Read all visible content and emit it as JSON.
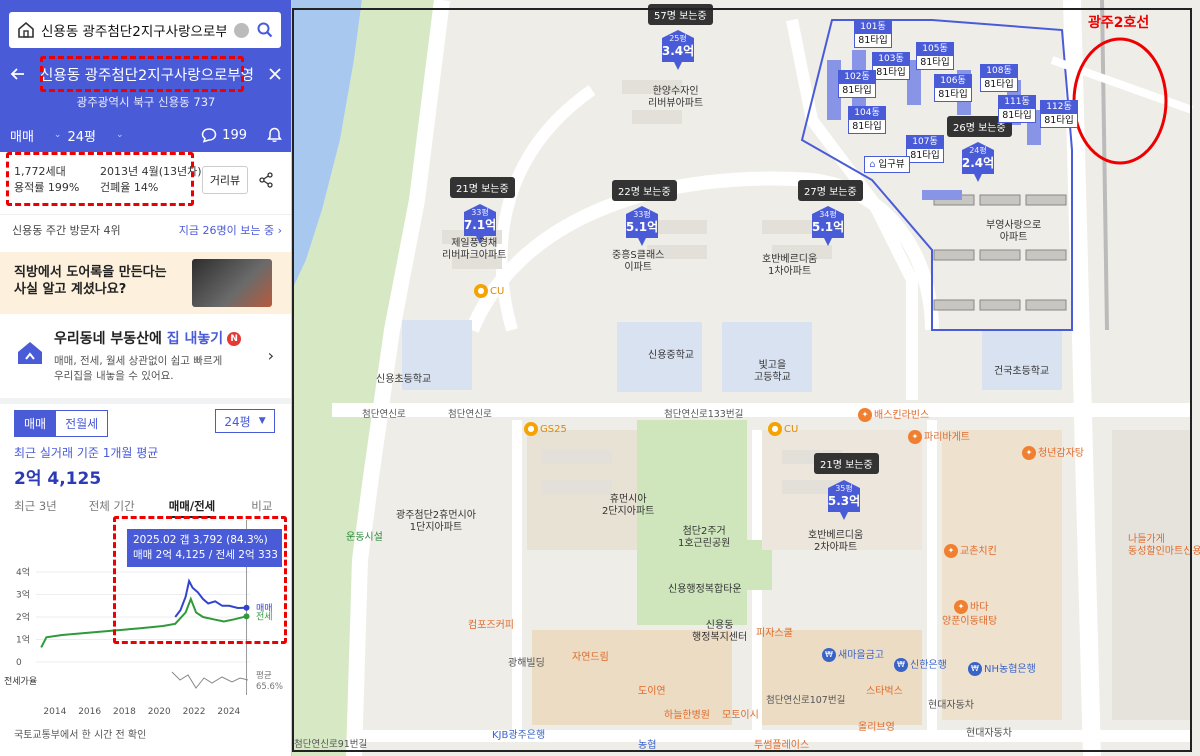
{
  "search": {
    "query": "신용동 광주첨단2지구사랑으로부영"
  },
  "header": {
    "title": "신용동 광주첨단2지구사랑으로부영",
    "address": "광주광역시 북구 신용동 737"
  },
  "tabs": {
    "deal": "매매",
    "size": "24평",
    "comments": "199"
  },
  "info": {
    "households": "1,772세대",
    "built": "2013년 4월(13년차)",
    "far": "용적률 199%",
    "bcr": "건폐율 14%",
    "street_view": "거리뷰"
  },
  "visitors": {
    "left": "신용동 주간 방문자 4위",
    "right": "지금 26명이 보는 중 ›"
  },
  "banner": {
    "line1": "직방에서 도어록을 만든다는",
    "line2": "사실 알고 계셨나요?"
  },
  "promo": {
    "title_a": "우리동네 부동산에 ",
    "title_b": "집 내놓기",
    "badge": "N",
    "desc1": "매매, 전세, 월세 상관없이 쉽고 빠르게",
    "desc2": "우리집을 내놓을 수 있어요."
  },
  "deal_tabs": {
    "sale": "매매",
    "rent": "전월세",
    "size": "24평"
  },
  "avg": {
    "label": "최근 실거래 기준 1개월 평균",
    "value": "2억 4,125"
  },
  "range_tabs": [
    "최근 3년",
    "전체 기간",
    "매매/전세",
    "비교"
  ],
  "tooltip": {
    "line1": "2025.02  갭 3,792 (84.3%)",
    "line2": "매매 2억 4,125 / 전세 2억 333"
  },
  "source": "국토교통부에서 한 시간 전 확인",
  "chart_data": {
    "type": "line",
    "x_ticks": [
      "2014",
      "2016",
      "2018",
      "2020",
      "2022",
      "2024"
    ],
    "y_ticks": [
      "4억",
      "3억",
      "2억",
      "1억",
      "0"
    ],
    "ylim": [
      0,
      4
    ],
    "series": [
      {
        "name": "매매",
        "color": "#3344cc",
        "points": [
          [
            2021.0,
            2.0
          ],
          [
            2021.3,
            2.3
          ],
          [
            2021.6,
            2.9
          ],
          [
            2021.8,
            3.6
          ],
          [
            2022.0,
            3.3
          ],
          [
            2022.3,
            3.1
          ],
          [
            2022.6,
            2.8
          ],
          [
            2022.9,
            2.6
          ],
          [
            2023.3,
            2.7
          ],
          [
            2023.7,
            2.5
          ],
          [
            2024.1,
            2.5
          ],
          [
            2024.6,
            2.4
          ],
          [
            2025.1,
            2.41
          ]
        ]
      },
      {
        "name": "전세",
        "color": "#2e9a3a",
        "points": [
          [
            2013.3,
            0.65
          ],
          [
            2013.6,
            1.1
          ],
          [
            2014.5,
            1.2
          ],
          [
            2016.0,
            1.3
          ],
          [
            2017.5,
            1.4
          ],
          [
            2019.0,
            1.5
          ],
          [
            2020.3,
            1.6
          ],
          [
            2021.0,
            1.7
          ],
          [
            2021.6,
            2.2
          ],
          [
            2021.9,
            2.8
          ],
          [
            2022.2,
            2.2
          ],
          [
            2022.6,
            2.0
          ],
          [
            2023.2,
            1.9
          ],
          [
            2023.8,
            1.8
          ],
          [
            2024.4,
            1.9
          ],
          [
            2025.1,
            2.03
          ]
        ]
      }
    ],
    "ratio_label": "전세가율",
    "ratio_value": "평균\n65.6%"
  },
  "map": {
    "line_label": "광주2호선",
    "markers": [
      {
        "viewers": "57명 보는중",
        "size": "25평",
        "price": "3.4억"
      },
      {
        "viewers": "21명 보는중",
        "size": "33평",
        "price": "7.1억"
      },
      {
        "viewers": "22명 보는중",
        "size": "33평",
        "price": "5.1억"
      },
      {
        "viewers": "27명 보는중",
        "size": "34평",
        "price": "5.1억"
      },
      {
        "viewers": "26명 보는중",
        "size": "24평",
        "price": "2.4억"
      },
      {
        "viewers": "21명 보는중",
        "size": "35평",
        "price": "5.3억"
      }
    ],
    "units": [
      "101동",
      "103동",
      "102동",
      "104동",
      "105동",
      "106동",
      "108동",
      "111동",
      "112동",
      "107동"
    ],
    "unit_type": "81타입",
    "entrance": "입구뷰",
    "labels": {
      "hanyang": "한양수자인\n리버뷰아파트",
      "jeil": "제일풍경채\n리버파크아파트",
      "jungheung": "중흥S클래스\n이파트",
      "hoban1": "호반베르디움\n1차아파트",
      "buyoung": "부영사랑으로\n아파트",
      "sinyong_elem": "신용초등학교",
      "sinyong_mid": "신용중학교",
      "bitgoeul": "빛고을\n고등학교",
      "geonguk": "건국초등학교",
      "humansia": "광주첨단2휴먼시아\n1단지아파트",
      "humansia2": "휴먼시아\n2단지아파트",
      "park": "첨단2주거\n1호근린공원",
      "hoban2": "호반베르디움\n2차아파트",
      "welfare": "신용동\n행정복지센터",
      "tower": "신용행정복합타운",
      "gs25": "GS25",
      "cu1": "CU",
      "cu2": "CU",
      "baskin": "배스킨라빈스",
      "paris": "파리바게트",
      "cheongnyeon": "청년감자탕",
      "kyochon": "교촌치킨",
      "bada": "바다",
      "yangpung": "양푼이동태탕",
      "sinhan": "신한은행",
      "nh": "NH농협은행",
      "hyundai1": "현대자동차",
      "hyundai2": "현대자동차",
      "natural": "나들가게\n동성할인마트신용점",
      "semaul": "새마을금고",
      "starbucks": "스타벅스",
      "olive": "올리브영",
      "twosome": "투썸플레이스",
      "kjb": "KJB광주은행",
      "nonghyup": "농협",
      "hanuri": "하늘한병원",
      "motoisi": "모토이시",
      "doyeon": "도이연",
      "pizza": "피자스쿨",
      "jayeon": "자연드림",
      "coffee": "컴포즈커피",
      "gwanghae": "광해빌딩",
      "sports": "운동시설",
      "road1": "첨단연신로133번길",
      "road2": "첨단연신로107번길",
      "road3": "첨단연신로91번길",
      "road4": "첨단연신로",
      "road5": "첨단연신로"
    }
  }
}
